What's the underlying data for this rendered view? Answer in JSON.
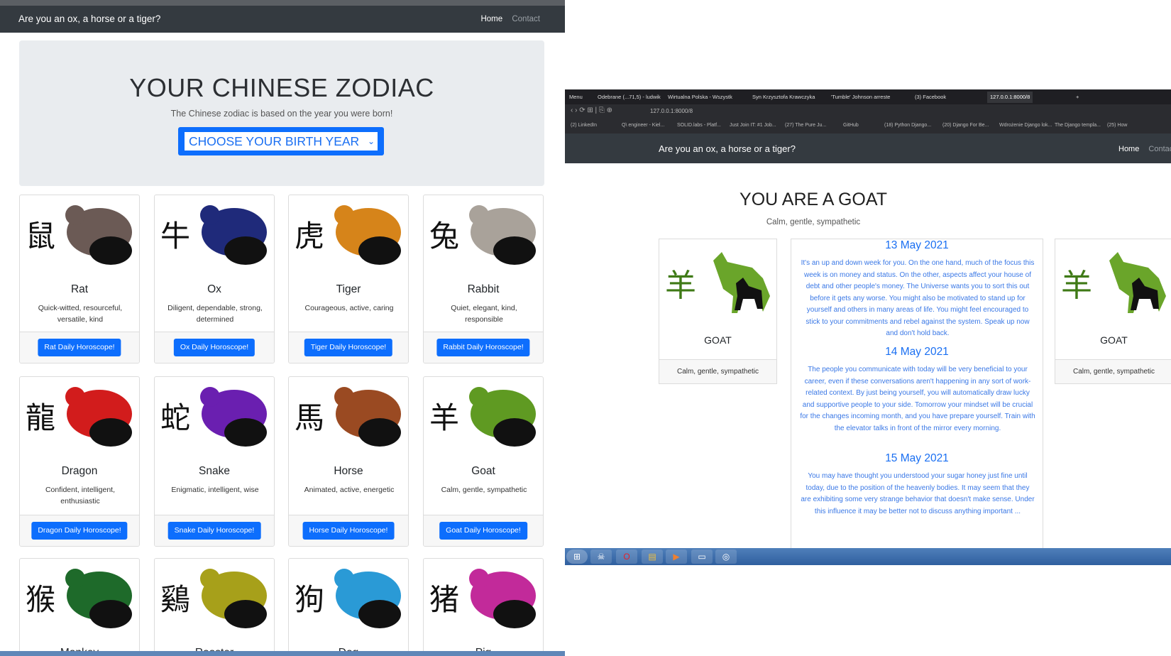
{
  "left": {
    "brand": "Are you an ox, a horse or a tiger?",
    "nav": {
      "home": "Home",
      "contact": "Contact"
    },
    "jumbotron": {
      "title": "YOUR CHINESE ZODIAC",
      "subtitle": "The Chinese zodiac is based on the year you were born!",
      "select_value": "CHOOSE YOUR BIRTH YEAR"
    },
    "cards": [
      {
        "name": "Rat",
        "desc": "Quick-witted, resourceful, versatile, kind",
        "button": "Rat Daily Horoscope!",
        "char": "鼠",
        "icon": "rat-icon",
        "color": "#6b5a55"
      },
      {
        "name": "Ox",
        "desc": "Diligent, dependable, strong, determined",
        "button": "Ox Daily Horoscope!",
        "char": "牛",
        "icon": "ox-icon",
        "color": "#1f2a7a"
      },
      {
        "name": "Tiger",
        "desc": "Courageous, active, caring",
        "button": "Tiger Daily Horoscope!",
        "char": "虎",
        "icon": "tiger-icon",
        "color": "#d6841a"
      },
      {
        "name": "Rabbit",
        "desc": "Quiet, elegant, kind, responsible",
        "button": "Rabbit Daily Horoscope!",
        "char": "兔",
        "icon": "rabbit-icon",
        "color": "#a9a29a"
      },
      {
        "name": "Dragon",
        "desc": "Confident, intelligent, enthusiastic",
        "button": "Dragon Daily Horoscope!",
        "char": "龍",
        "icon": "dragon-icon",
        "color": "#d21c1c"
      },
      {
        "name": "Snake",
        "desc": "Enigmatic, intelligent, wise",
        "button": "Snake Daily Horoscope!",
        "char": "蛇",
        "icon": "snake-icon",
        "color": "#6a1fb0"
      },
      {
        "name": "Horse",
        "desc": "Animated, active, energetic",
        "button": "Horse Daily Horoscope!",
        "char": "馬",
        "icon": "horse-icon",
        "color": "#9a4a22"
      },
      {
        "name": "Goat",
        "desc": "Calm, gentle, sympathetic",
        "button": "Goat Daily Horoscope!",
        "char": "羊",
        "icon": "goat-icon",
        "color": "#5f9a22"
      },
      {
        "name": "Monkey",
        "desc": "",
        "button": "",
        "char": "猴",
        "icon": "monkey-icon",
        "color": "#1e6a2a"
      },
      {
        "name": "Rooster",
        "desc": "",
        "button": "",
        "char": "鷄",
        "icon": "rooster-icon",
        "color": "#a7a01a"
      },
      {
        "name": "Dog",
        "desc": "",
        "button": "",
        "char": "狗",
        "icon": "dog-icon",
        "color": "#2a9ad6"
      },
      {
        "name": "Pig",
        "desc": "",
        "button": "",
        "char": "猪",
        "icon": "pig-icon",
        "color": "#c22a9a"
      }
    ]
  },
  "right": {
    "tabs": [
      {
        "label": "Menu"
      },
      {
        "label": "Odebrane (...71,5) - ludwik"
      },
      {
        "label": "Wirtualna Polska - Wszystk"
      },
      {
        "label": "Syn Krzysztofa Krawczyka"
      },
      {
        "label": "'Tumble' Johnson arreste"
      },
      {
        "label": "(3) Facebook"
      },
      {
        "label": "127.0.0.1:8000/8"
      }
    ],
    "url": "127.0.0.1:8000/8",
    "bookmarks": [
      "(2) LinkedIn",
      "Q\\ engineer - Kiel...",
      "SOLID.labs - Platf...",
      "Just Join IT: #1 Job...",
      "(27) The Pure Ju...",
      "GitHub",
      "(18) Python Django...",
      "(20) Django For Be...",
      "Wdrożenie Django lok...",
      "The Django templa...",
      "(25) How"
    ],
    "brand": "Are you an ox, a horse or a tiger?",
    "nav": {
      "home": "Home",
      "contact": "Contact"
    },
    "title": "YOU ARE A GOAT",
    "subtitle": "Calm, gentle, sympathetic",
    "goat_card": {
      "name": "GOAT",
      "desc": "Calm, gentle, sympathetic",
      "char": "羊"
    },
    "horoscopes": [
      {
        "date": "13 May 2021",
        "text": "It's an up and down week for you. On the one hand, much of the focus this week is on money and status. On the other, aspects affect your house of debt and other people's money. The Universe wants you to sort this out before it gets any worse. You might also be motivated to stand up for yourself and others in many areas of life. You might feel encouraged to stick to your commitments and rebel against the system. Speak up now and don't hold back."
      },
      {
        "date": "14 May 2021",
        "text": "The people you communicate with today will be very beneficial to your career, even if these conversations aren't happening in any sort of work-related context. By just being yourself, you will automatically draw lucky and supportive people to your side. Tomorrow your mindset will be crucial for the changes incoming month, and you have prepare yourself. Train with the elevator talks in front of the mirror every morning."
      },
      {
        "date": "15 May 2021",
        "text": "You may have thought you understood your sugar honey just fine until today, due to the position of the heavenly bodies. It may seem that they are exhibiting some very strange behavior that doesn't make sense. Under this influence it may be better not to discuss anything important ..."
      }
    ]
  }
}
